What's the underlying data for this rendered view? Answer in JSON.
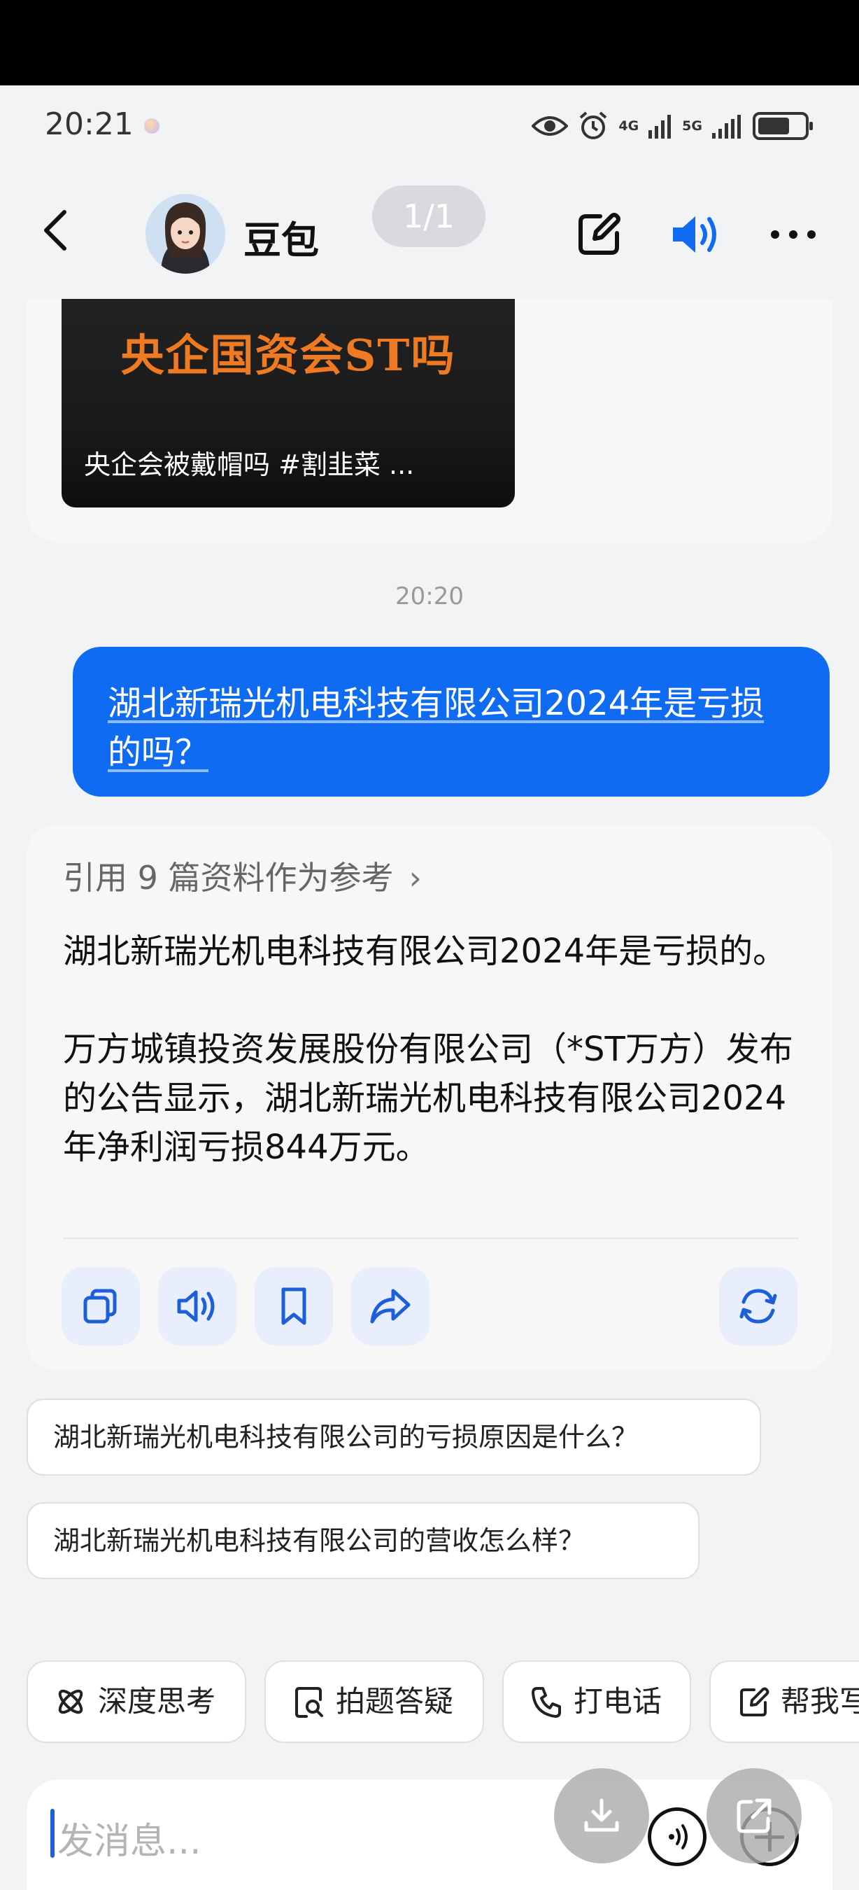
{
  "status_bar": {
    "time": "20:21",
    "network_1": "4G",
    "network_2": "5G"
  },
  "header": {
    "title": "豆包",
    "page_indicator": "1/1"
  },
  "video_card": {
    "headline": "央企国资会ST吗",
    "caption": "央企会被戴帽吗 #割韭菜 ..."
  },
  "chat": {
    "timestamp": "20:20",
    "user_message": "湖北新瑞光机电科技有限公司2024年是亏损的吗？",
    "references": "引用 9 篇资料作为参考",
    "answer_p1": "湖北新瑞光机电科技有限公司2024年是亏损的。",
    "answer_p2": "万方城镇投资发展股份有限公司（*ST万方）发布的公告显示，湖北新瑞光机电科技有限公司2024年净利润亏损844万元。"
  },
  "suggestions": [
    "湖北新瑞光机电科技有限公司的亏损原因是什么？",
    "湖北新瑞光机电科技有限公司的营收怎么样？"
  ],
  "quick_actions": [
    {
      "label": "深度思考",
      "icon": "atom-icon"
    },
    {
      "label": "拍题答疑",
      "icon": "search-doc-icon"
    },
    {
      "label": "打电话",
      "icon": "phone-icon"
    },
    {
      "label": "帮我写",
      "icon": "edit-icon"
    }
  ],
  "input": {
    "placeholder": "发消息..."
  },
  "colors": {
    "accent": "#0f6cf2",
    "bubble_bg": "#f7f7f8",
    "page_bg": "#f2f3f5"
  }
}
